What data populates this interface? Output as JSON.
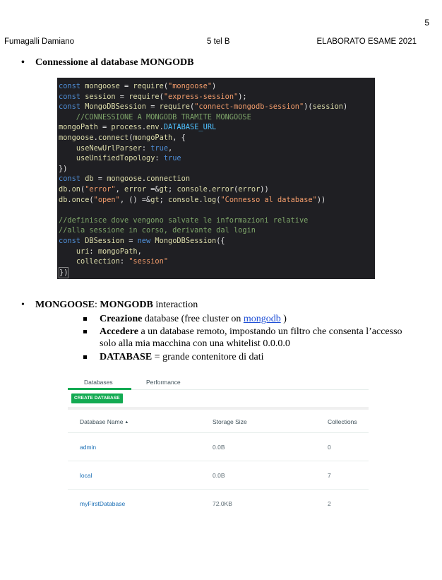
{
  "page_number": "5",
  "header": {
    "left": "Fumagalli Damiano",
    "center": "5 tel B",
    "right": "ELABORATO ESAME 2021"
  },
  "section1": {
    "bullet": "•",
    "title": "Connessione al database MONGODB"
  },
  "code_lines": [
    "const mongoose = require(\"mongoose\")",
    "const session = require(\"express-session\");",
    "const MongoDBSession = require(\"connect-mongodb-session\")(session)",
    "    //CONNESSIONE A MONGODB TRAMITE MONGOOSE",
    "mongoPath = process.env.DATABASE_URL",
    "mongoose.connect(mongoPath, {",
    "    useNewUrlParser: true,",
    "    useUnifiedTopology: true",
    "})",
    "const db = mongoose.connection",
    "db.on(\"error\", error => console.error(error))",
    "db.once(\"open\", () => console.log(\"Connesso al database\"))",
    "",
    "//definisce dove vengono salvate le informazioni relative",
    "//alla sessione in corso, derivante dal login",
    "const DBSession = new MongoDBSession({",
    "    uri: mongoPath,",
    "    collection: \"session\"",
    "})"
  ],
  "section2": {
    "bullet": "•",
    "title_bold1": "MONGOOSE",
    "colon": ": ",
    "title_bold2": "MONGODB",
    "title_rest": " interaction",
    "items": [
      {
        "bold": "Creazione",
        "text": " database (free cluster on ",
        "link": "mongodb",
        "after": " )"
      },
      {
        "bold": "Accedere",
        "text": " a un database remoto, impostando un filtro che consenta l’accesso",
        "text2": "solo alla mia macchina con una whitelist 0.0.0.0"
      },
      {
        "bold": "DATABASE",
        "text": " = grande contenitore di dati"
      }
    ]
  },
  "db_panel": {
    "tabs": [
      "Databases",
      "Performance"
    ],
    "create_button": "CREATE DATABASE",
    "columns": [
      "Database Name",
      "Storage Size",
      "Collections"
    ],
    "sort_icon": "▲",
    "rows": [
      {
        "name": "admin",
        "size": "0.0B",
        "collections": "0"
      },
      {
        "name": "local",
        "size": "0.0B",
        "collections": "7"
      },
      {
        "name": "myFirstDatabase",
        "size": "72.0KB",
        "collections": "2"
      }
    ],
    "colors": {
      "accent": "#13aa52",
      "link": "#1a6eb5"
    }
  }
}
